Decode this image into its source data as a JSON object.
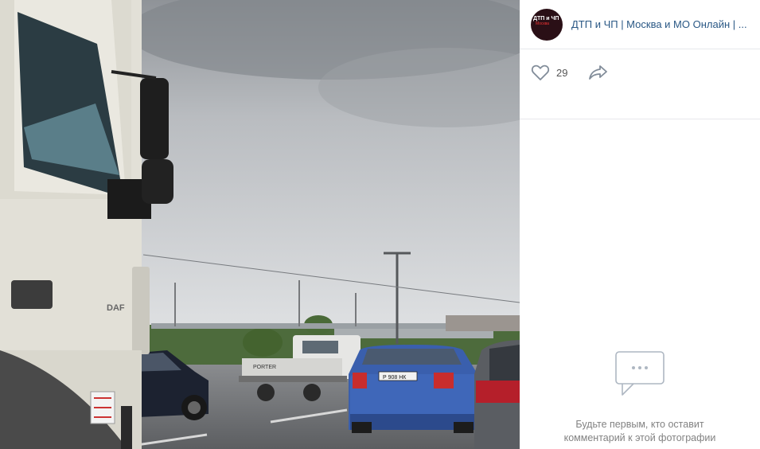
{
  "post": {
    "author_name": "ДТП и ЧП | Москва и МО Онлайн | ...",
    "avatar_text_line1": "ДТП и ЧП",
    "avatar_text_line2": "Москва",
    "likes_count": "29"
  },
  "photo": {
    "truck_brand": "DAF",
    "van_label": "PORTER",
    "plate_text": "Р 908 НК"
  },
  "comments": {
    "empty_line1": "Будьте первым, кто оставит",
    "empty_line2": "комментарий к этой фотографии"
  },
  "icons": {
    "like": "heart-icon",
    "share": "share-arrow-icon",
    "comments": "comments-bubble-icon"
  },
  "colors": {
    "link": "#2a5885",
    "muted": "#828282",
    "icon": "#818c99",
    "divider": "#e7e8ec"
  }
}
